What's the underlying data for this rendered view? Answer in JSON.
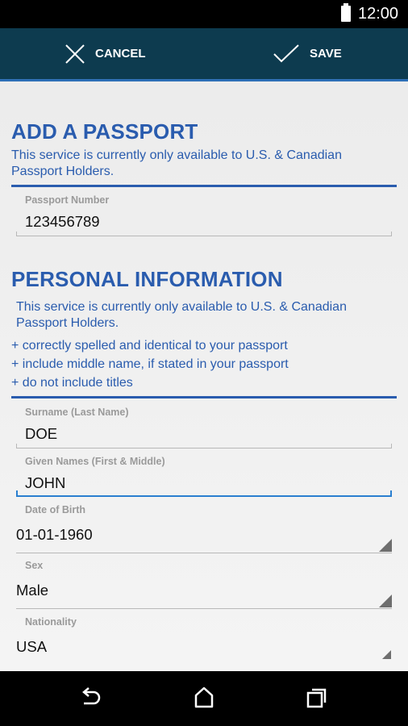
{
  "status_bar": {
    "time": "12:00"
  },
  "action_bar": {
    "cancel_label": "CANCEL",
    "save_label": "SAVE"
  },
  "passport_section": {
    "title": "ADD A PASSPORT",
    "info": "This service is currently only available to U.S. & Canadian Passport Holders.",
    "passport_number": {
      "label": "Passport Number",
      "value": "123456789"
    }
  },
  "personal_section": {
    "title": "PERSONAL INFORMATION",
    "info": "This service is currently only available to U.S. & Canadian Passport Holders.",
    "notes": [
      "+ correctly spelled and identical to your passport",
      "+ include middle name, if stated in your passport",
      "+ do not include titles"
    ],
    "surname": {
      "label": "Surname (Last Name)",
      "value": "DOE"
    },
    "given_names": {
      "label": "Given Names (First & Middle)",
      "value": "JOHN"
    },
    "date_of_birth": {
      "label": "Date of Birth",
      "value": "01-01-1960"
    },
    "sex": {
      "label": "Sex",
      "value": "Male"
    },
    "nationality": {
      "label": "Nationality",
      "value": "USA"
    }
  },
  "colors": {
    "accent": "#2a5cae",
    "action_bar": "#0d3b4f",
    "focus": "#2a7fd0"
  },
  "icons": {
    "cancel": "close-icon",
    "save": "checkmark-icon",
    "back": "back-icon",
    "home": "home-icon",
    "recents": "recents-icon"
  }
}
